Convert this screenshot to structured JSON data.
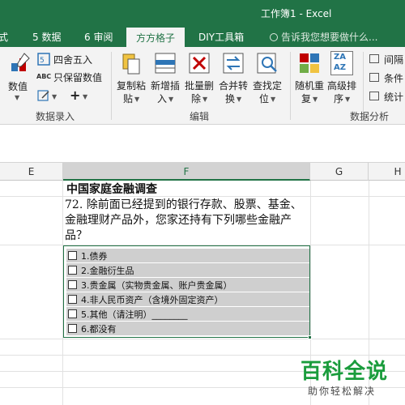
{
  "window": {
    "title": "工作簿1 - Excel"
  },
  "tabs": [
    {
      "label": "式"
    },
    {
      "label": "5 数据"
    },
    {
      "label": "6 审阅"
    },
    {
      "label": "方方格子",
      "active": true
    },
    {
      "label": "DIY工具箱"
    }
  ],
  "tell_me": {
    "placeholder": "告诉我您想要做什么..."
  },
  "ribbon": {
    "group_numeric": {
      "label": "数据录入",
      "big_button_label": "数值",
      "round_label": "四舍五入",
      "keep_value_label": "只保留数值",
      "abc_glyph": "ABC",
      "plus_glyph": "+"
    },
    "group_edit": {
      "label": "编辑",
      "buttons": [
        {
          "line1": "复制粘",
          "line2": "贴"
        },
        {
          "line1": "新增插",
          "line2": "入"
        },
        {
          "line1": "批量删",
          "line2": "除"
        },
        {
          "line1": "合并转",
          "line2": "换"
        },
        {
          "line1": "查找定",
          "line2": "位"
        }
      ]
    },
    "group_analysis": {
      "label": "数据分析",
      "buttons": [
        {
          "line1": "随机重",
          "line2": "复"
        },
        {
          "line1": "高级排",
          "line2": "序"
        }
      ],
      "sort_icon_text_top": "ZA",
      "sort_icon_text_bottom": "AZ",
      "small_items": [
        "间隔",
        "条件",
        "统计"
      ]
    },
    "colors": {
      "accent": "#217346"
    }
  },
  "sheet": {
    "columns": [
      "E",
      "F",
      "G",
      "H"
    ],
    "selected_column": "F",
    "title": "中国家庭金融调查",
    "question": "72. 除前面已经提到的银行存款、股票、基金、金融理财产品外，您家还持有下列哪些金融产品？",
    "options": [
      {
        "label": "1.债券",
        "checked": false
      },
      {
        "label": "2.金融衍生品",
        "checked": false
      },
      {
        "label": "3.贵金属（实物贵金属、账户贵金属）",
        "checked": false
      },
      {
        "label": "4.非人民币资产（含境外固定资产）",
        "checked": false
      },
      {
        "label": "5.其他（请注明）________",
        "checked": false
      },
      {
        "label": "6.都没有",
        "checked": false
      }
    ]
  },
  "watermark": {
    "logo_text": "百科全说",
    "sub_text": "助你轻松解决"
  }
}
